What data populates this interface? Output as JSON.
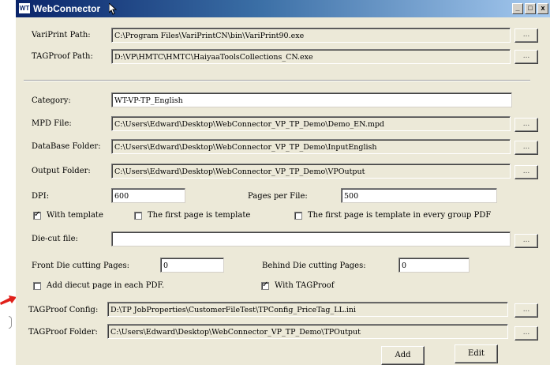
{
  "window": {
    "title": "WebConnector",
    "minimize": "_",
    "maximize": "□",
    "close": "x"
  },
  "paths": {
    "variprint_label": "VariPrint Path:",
    "variprint_value": "C:\\Program Files\\VariPrintCN\\bin\\VariPrint90.exe",
    "tagproof_label": "TAGProof Path:",
    "tagproof_value": "D:\\VP\\HMTC\\HMTC\\HaiyaaToolsCollections_CN.exe",
    "browse": "..."
  },
  "form": {
    "category_label": "Category:",
    "category_value": "WT-VP-TP_English",
    "mpd_label": "MPD File:",
    "mpd_value": "C:\\Users\\Edward\\Desktop\\WebConnector_VP_TP_Demo\\Demo_EN.mpd",
    "database_label": "DataBase Folder:",
    "database_value": "C:\\Users\\Edward\\Desktop\\WebConnector_VP_TP_Demo\\InputEnglish",
    "output_label": "Output Folder:",
    "output_value": "C:\\Users\\Edward\\Desktop\\WebConnector_VP_TP_Demo\\VPOutput",
    "dpi_label": "DPI:",
    "dpi_value": "600",
    "pages_label": "Pages per File:",
    "pages_value": "500",
    "with_template": "With template",
    "first_page_template": "The first page is template",
    "first_page_group": "The first page is template in every group PDF",
    "diecut_label": "Die-cut file:",
    "diecut_value": "",
    "front_die_label": "Front Die cutting Pages:",
    "front_die_value": "0",
    "behind_die_label": "Behind Die cutting Pages:",
    "behind_die_value": "0",
    "add_diecut": "Add diecut page in each PDF.",
    "with_tagproof": "With TAGProof",
    "tp_config_label": "TAGProof Config:",
    "tp_config_value": "D:\\TP JobProperties\\CustomerFileTest\\TPConfig_PriceTag_LL.ini",
    "tp_folder_label": "TAGProof Folder:",
    "tp_folder_value": "C:\\Users\\Edward\\Desktop\\WebConnector_VP_TP_Demo\\TPOutput",
    "checked_mark": "✓"
  },
  "checkboxes": {
    "with_template": true,
    "first_page_template": false,
    "first_page_group": false,
    "add_diecut": false,
    "with_tagproof": true
  },
  "buttons": {
    "add": "Add",
    "edit": "Edit"
  },
  "colors": {
    "accent_arrow": "#e0201a",
    "title_bar": "#0a246a"
  }
}
